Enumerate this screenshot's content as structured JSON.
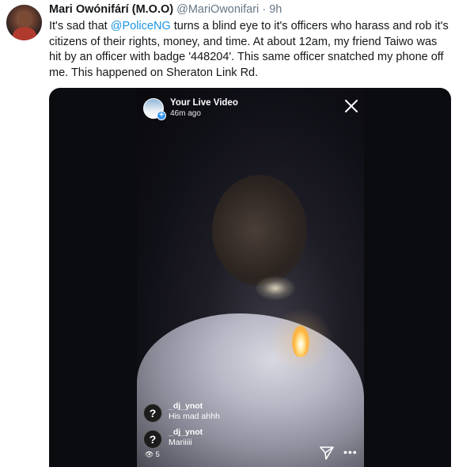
{
  "tweet": {
    "display_name": "Mari Owónifárí (M.O.O)",
    "handle": "@MariOwonifari",
    "separator": "·",
    "time": "9h",
    "text_before_mention": "It's sad that ",
    "mention": "@PoliceNG",
    "text_after_mention": " turns a blind eye to it's officers who harass and rob it's citizens of their rights, money, and time. At about 12am, my friend Taiwo was hit by an officer with badge '448204'. This same officer snatched my phone off me. This happened on Sheraton Link Rd."
  },
  "live_video": {
    "title": "Your Live Video",
    "subtitle": "46m ago",
    "avatar_badge": "+",
    "comments": [
      {
        "avatar_glyph": "?",
        "user": "_dj_ynot",
        "text": "His mad ahhh"
      },
      {
        "avatar_glyph": "?",
        "user": "_dj_ynot",
        "text": "Mariiiii"
      }
    ],
    "viewer_count": "5",
    "more_glyph": "•••"
  },
  "icons": {
    "close": "close-icon",
    "send": "send-icon",
    "eye": "eye-icon",
    "more": "more-icon"
  },
  "colors": {
    "link": "#1b95e0",
    "secondary_text": "#657786",
    "primary_text": "#14171a"
  }
}
